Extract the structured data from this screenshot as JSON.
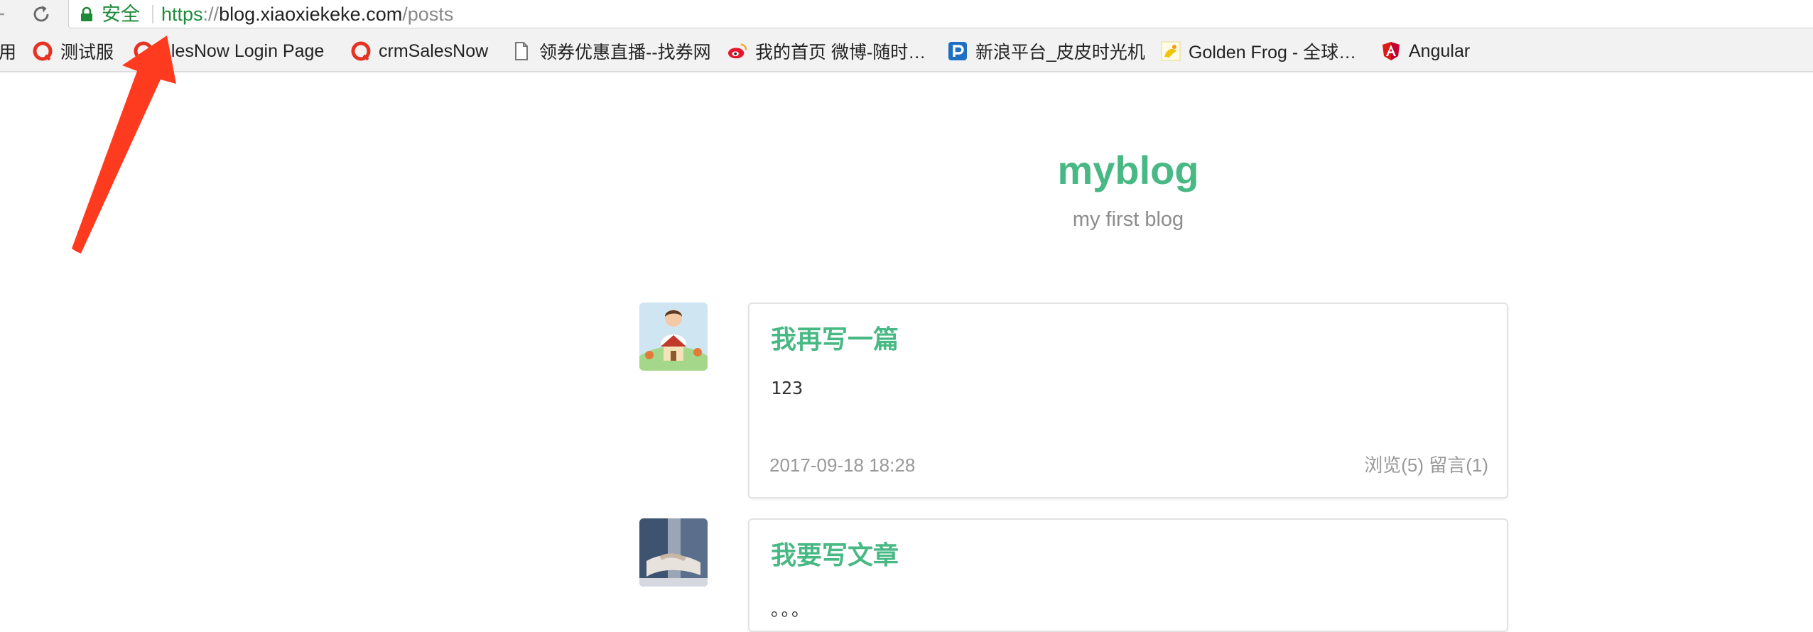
{
  "browser": {
    "secure_label": "安全",
    "url": {
      "scheme": "https",
      "separator": "://",
      "host": "blog.xiaoxiekeke.com",
      "path": "/posts"
    },
    "bookmarks": [
      {
        "label": "用",
        "icon": "apps-icon"
      },
      {
        "label": "测试服",
        "icon": "red-circle-icon"
      },
      {
        "label": "alesNow Login Page",
        "icon": "red-circle-icon"
      },
      {
        "label": "crmSalesNow",
        "icon": "red-circle-icon"
      },
      {
        "label": "领券优惠直播--找券网",
        "icon": "page-icon"
      },
      {
        "label": "我的首页 微博-随时…",
        "icon": "weibo-icon"
      },
      {
        "label": "新浪平台_皮皮时光机",
        "icon": "pipi-icon"
      },
      {
        "label": "Golden Frog - 全球…",
        "icon": "golden-frog-icon"
      },
      {
        "label": "Angular",
        "icon": "angular-icon"
      }
    ],
    "colors": {
      "secure_green": "#1d8a3a",
      "bookmark_bar": "#f2f2f2"
    }
  },
  "site": {
    "title": "myblog",
    "subtitle": "my first blog",
    "accent_color": "#48b884"
  },
  "posts": [
    {
      "title": "我再写一篇",
      "body": "123",
      "date": "2017-09-18 18:28",
      "meta": "浏览(5) 留言(1)",
      "avatar": "avatar-person-house"
    },
    {
      "title": "我要写文章",
      "body": "。。。",
      "avatar": "avatar-business-handshake"
    }
  ],
  "annotation": {
    "type": "arrow",
    "color": "#ff3b1f",
    "points_to": "address-bar-url"
  }
}
